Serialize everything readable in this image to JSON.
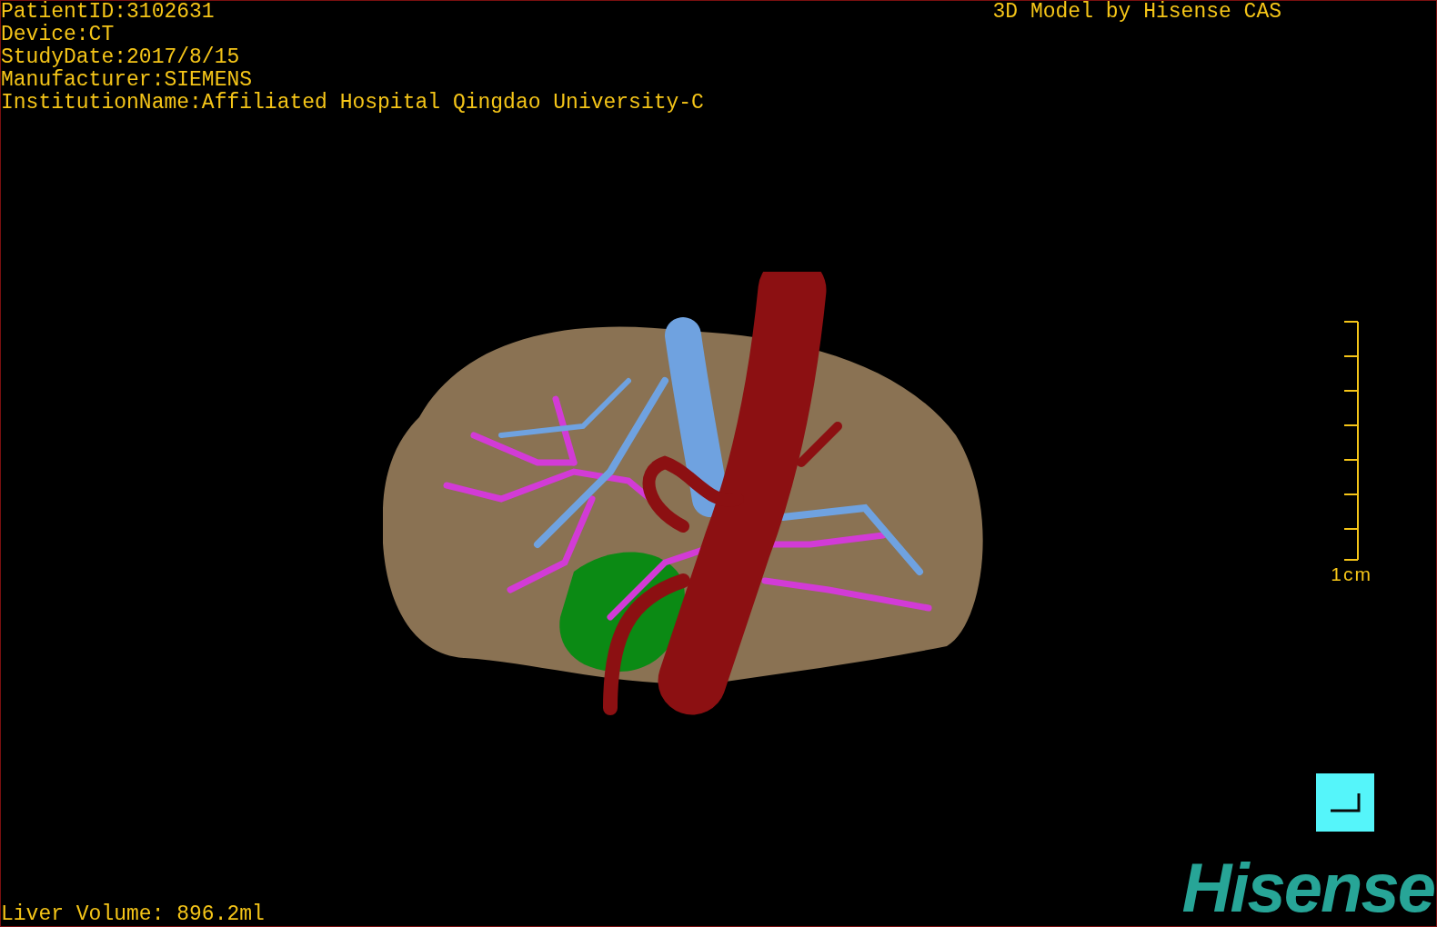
{
  "header": {
    "info_lines": [
      "PatientID:3102631",
      "Device:CT",
      "StudyDate:2017/8/15",
      "Manufacturer:SIEMENS",
      "InstitutionName:Affiliated Hospital Qingdao University-C"
    ],
    "title": "3D Model by Hisense CAS"
  },
  "scale_bar": {
    "label": "1cm"
  },
  "footer": {
    "volume": "Liver Volume: 896.2ml",
    "logo": "Hisense"
  }
}
